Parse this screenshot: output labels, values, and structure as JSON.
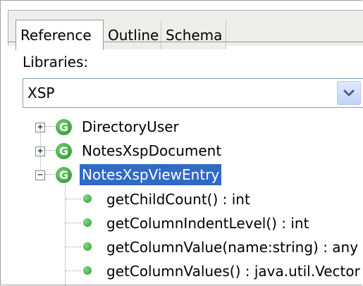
{
  "tabs": [
    {
      "label": "Reference",
      "active": true
    },
    {
      "label": "Outline",
      "active": false
    },
    {
      "label": "Schema",
      "active": false
    }
  ],
  "libraries": {
    "label": "Libraries:",
    "selected": "XSP"
  },
  "tree": {
    "classes": [
      {
        "name": "DirectoryUser",
        "expanded": false,
        "selected": false
      },
      {
        "name": "NotesXspDocument",
        "expanded": false,
        "selected": false
      },
      {
        "name": "NotesXspViewEntry",
        "expanded": true,
        "selected": true
      }
    ],
    "methods": [
      {
        "signature": "getChildCount() : int"
      },
      {
        "signature": "getColumnIndentLevel() : int"
      },
      {
        "signature": "getColumnValue(name:string) : any"
      },
      {
        "signature": "getColumnValues() : java.util.Vector"
      }
    ],
    "class_icon_letter": "G",
    "colors": {
      "selection": "#316ac5",
      "class_icon": "#2d8f2d"
    }
  }
}
